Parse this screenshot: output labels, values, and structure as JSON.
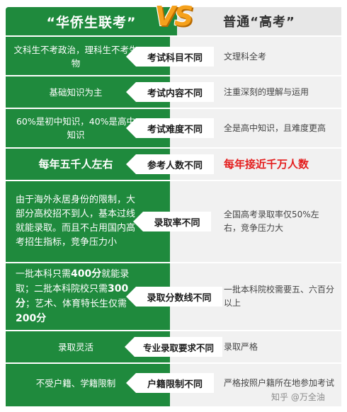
{
  "header": {
    "left_title": "“华侨生联考”",
    "vs": "VS",
    "right_title": "普通“高考”"
  },
  "rows": [
    {
      "left": "文科生不考政治，理科生不考生物",
      "tag": "考试科目不同",
      "right": "文理科全考"
    },
    {
      "left": "基础知识为主",
      "tag": "考试内容不同",
      "right": "注重深刻的理解与运用"
    },
    {
      "left": "60%是初中知识，40%是高中知识",
      "tag": "考试难度不同",
      "right": "全是高中知识，且难度更高"
    },
    {
      "left": "每年五千人左右",
      "tag": "参考人数不同",
      "right": "每年接近千万人数"
    },
    {
      "left": "由于海外永居身份的限制，大部分高校招不到人，基本过线就能录取。而且不占用国内高考招生指标，竞争压力小",
      "tag": "录取率不同",
      "right": "全国高考录取率仅50%左右，竞争压力大"
    },
    {
      "left_parts": [
        "一批本科只需",
        "400分",
        "就能录取；二批本科院校只需",
        "300分",
        "；艺术、体育特长生仅需",
        "200分"
      ],
      "tag": "录取分数线不同",
      "right": "一批本科院校需要五、六百分以上"
    },
    {
      "left": "录取灵活",
      "tag": "专业录取要求不同",
      "right": "录取严格"
    },
    {
      "left": "不受户籍、学籍限制",
      "tag": "户籍限制不同",
      "right": "严格按照户籍所在地参加考试"
    }
  ],
  "watermark": "知乎 @万全油",
  "colors": {
    "green": "#1f8a3d",
    "gray": "#f1f1f1",
    "red": "#e41d1d",
    "orange": "#f5a11c"
  }
}
